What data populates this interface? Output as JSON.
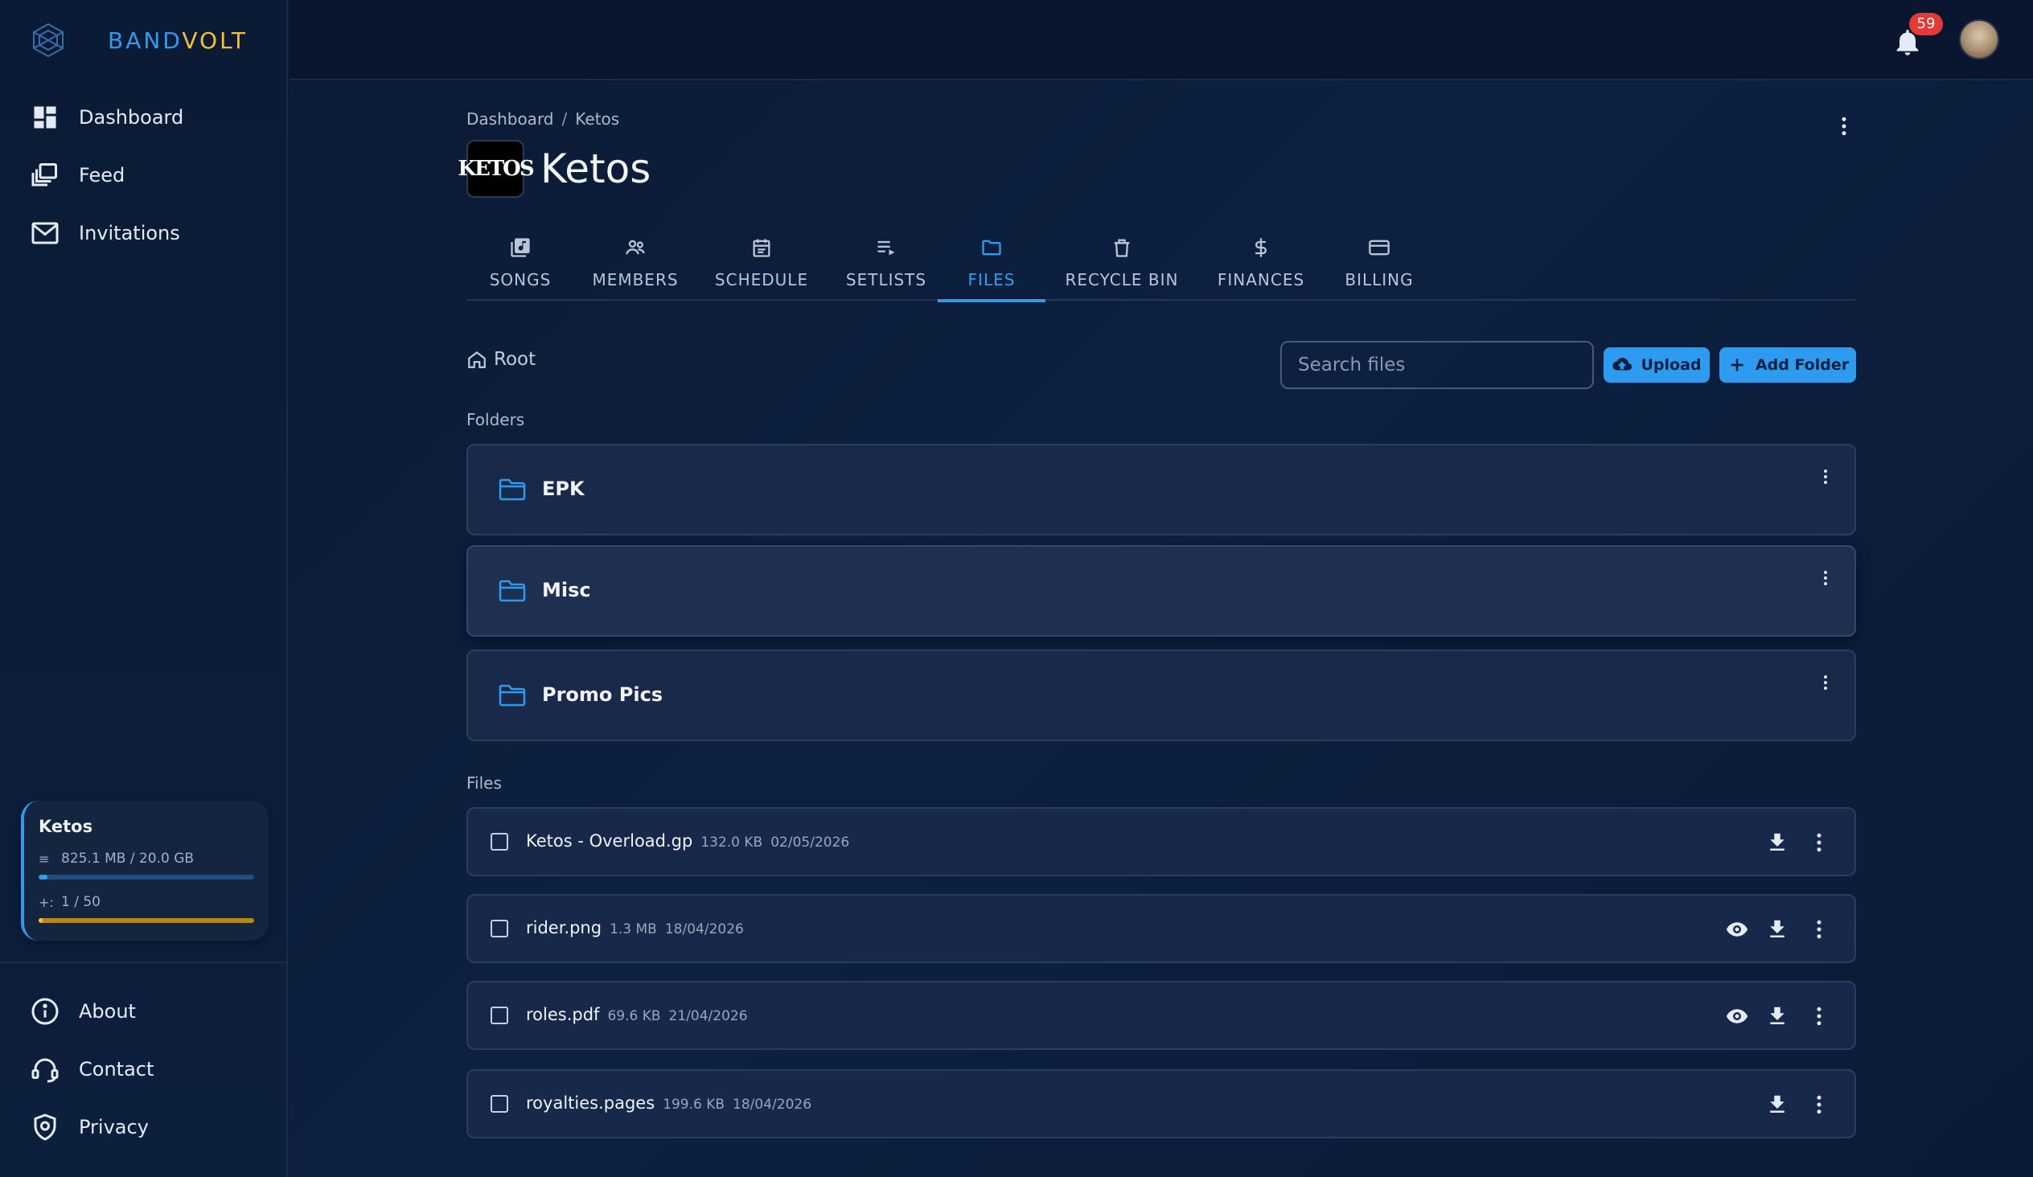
{
  "brand": {
    "name_part1": "BAND",
    "name_part2": "VOLT"
  },
  "sidebar": {
    "nav": [
      {
        "label": "Dashboard",
        "icon": "dashboard-icon"
      },
      {
        "label": "Feed",
        "icon": "feed-icon"
      },
      {
        "label": "Invitations",
        "icon": "mail-icon"
      }
    ],
    "band_card": {
      "name": "Ketos",
      "storage_text": "825.1 MB / 20.0 GB",
      "storage_fraction": 0.04,
      "members_text": "1 / 50",
      "members_fraction": 0.02
    },
    "footer_nav": [
      {
        "label": "About",
        "icon": "info-icon"
      },
      {
        "label": "Contact",
        "icon": "support-icon"
      },
      {
        "label": "Privacy",
        "icon": "shield-icon"
      }
    ]
  },
  "topbar": {
    "notification_count": "59"
  },
  "breadcrumb": {
    "root": "Dashboard",
    "separator": "/",
    "current": "Ketos"
  },
  "band": {
    "title": "Ketos",
    "logo_text": "KETOS"
  },
  "tabs": [
    {
      "label": "SONGS",
      "icon": "songs-icon"
    },
    {
      "label": "MEMBERS",
      "icon": "members-icon"
    },
    {
      "label": "SCHEDULE",
      "icon": "calendar-icon"
    },
    {
      "label": "SETLISTS",
      "icon": "setlist-icon"
    },
    {
      "label": "FILES",
      "icon": "folder-icon",
      "active": true
    },
    {
      "label": "RECYCLE BIN",
      "icon": "trash-icon"
    },
    {
      "label": "FINANCES",
      "icon": "dollar-icon"
    },
    {
      "label": "BILLING",
      "icon": "card-icon"
    }
  ],
  "files_toolbar": {
    "root_label": "Root",
    "search_placeholder": "Search files",
    "upload_label": "Upload",
    "add_folder_label": "Add Folder"
  },
  "folders_label": "Folders",
  "folders": [
    {
      "name": "EPK"
    },
    {
      "name": "Misc"
    },
    {
      "name": "Promo Pics"
    }
  ],
  "files_label": "Files",
  "files": [
    {
      "name": "Ketos - Overload.gp",
      "size": "132.0 KB",
      "date": "02/05/2026",
      "previewable": false
    },
    {
      "name": "rider.png",
      "size": "1.3 MB",
      "date": "18/04/2026",
      "previewable": true
    },
    {
      "name": "roles.pdf",
      "size": "69.6 KB",
      "date": "21/04/2026",
      "previewable": true
    },
    {
      "name": "royalties.pages",
      "size": "199.6 KB",
      "date": "18/04/2026",
      "previewable": false
    }
  ],
  "colors": {
    "accent": "#2d9cf0",
    "brand_yellow": "#f2c230",
    "badge": "#e53935",
    "background": "#0d2040"
  }
}
